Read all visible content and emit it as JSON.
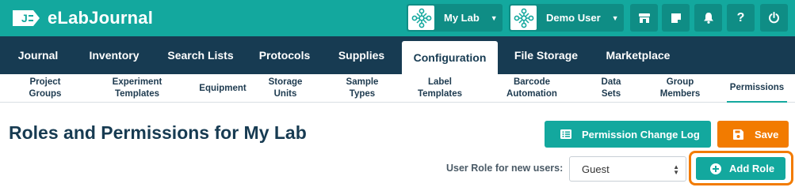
{
  "brand": {
    "name": "eLabJournal",
    "logo_glyph": "J"
  },
  "topbar": {
    "lab_selector": {
      "label": "My Lab",
      "icon": "network-nodes-icon"
    },
    "user_selector": {
      "label": "Demo User",
      "icon": "network-nodes-icon"
    },
    "buttons": [
      {
        "name": "store-icon"
      },
      {
        "name": "notes-icon"
      },
      {
        "name": "bell-icon"
      },
      {
        "name": "help-icon",
        "glyph": "?"
      },
      {
        "name": "power-icon"
      }
    ]
  },
  "main_nav": {
    "items": [
      {
        "label": "Journal"
      },
      {
        "label": "Inventory"
      },
      {
        "label": "Search Lists"
      },
      {
        "label": "Protocols"
      },
      {
        "label": "Supplies"
      },
      {
        "label": "Configuration"
      },
      {
        "label": "File Storage"
      },
      {
        "label": "Marketplace"
      }
    ],
    "active": "Configuration"
  },
  "sub_nav": {
    "items": [
      {
        "line1": "Project",
        "line2": "Groups"
      },
      {
        "line1": "Experiment",
        "line2": "Templates"
      },
      {
        "line1": "Equipment",
        "line2": ""
      },
      {
        "line1": "Storage",
        "line2": "Units"
      },
      {
        "line1": "Sample",
        "line2": "Types"
      },
      {
        "line1": "Label",
        "line2": "Templates"
      },
      {
        "line1": "Barcode",
        "line2": "Automation"
      },
      {
        "line1": "Data",
        "line2": "Sets"
      },
      {
        "line1": "Group",
        "line2": "Members"
      },
      {
        "line1": "Permissions",
        "line2": ""
      }
    ],
    "active": "Permissions"
  },
  "content": {
    "title": "Roles and Permissions for My Lab",
    "permission_log_button": "Permission Change Log",
    "save_button": "Save",
    "add_role_button": "Add Role",
    "role_label": "User Role for new users:",
    "role_select_value": "Guest"
  },
  "colors": {
    "teal": "#13a89e",
    "teal_dark": "#0f8d85",
    "navy": "#173b52",
    "orange": "#f27b00"
  }
}
